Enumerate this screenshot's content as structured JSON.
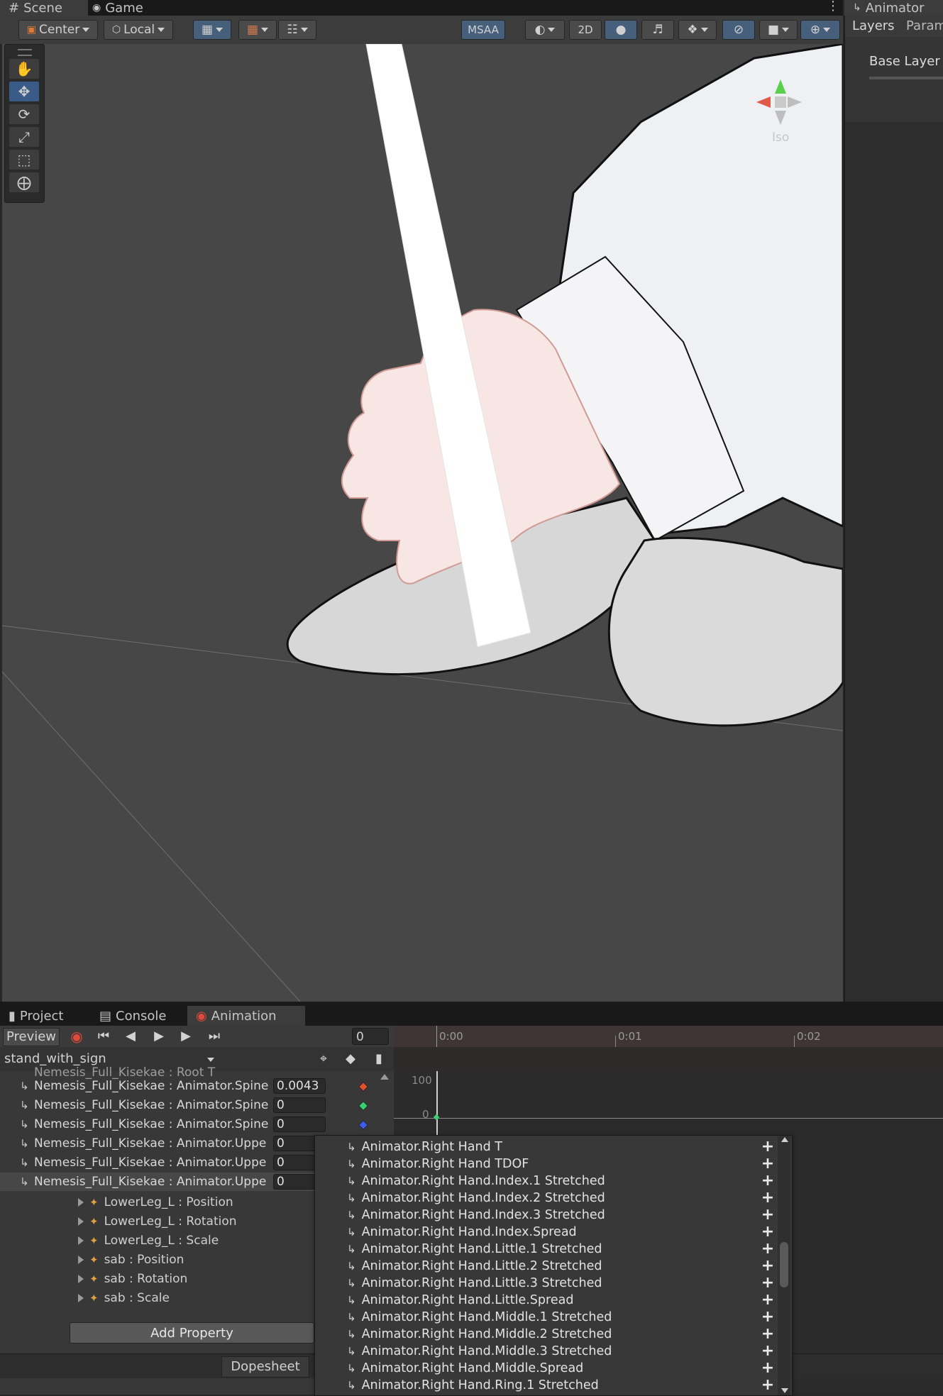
{
  "tabs": {
    "scene": "Scene",
    "game": "Game",
    "animator": "Animator"
  },
  "scene_toolbar": {
    "pivot": "Center",
    "space": "Local",
    "msaa": "MSAA",
    "mode_2d": "2D"
  },
  "scene_view": {
    "gizmo_label": "Iso"
  },
  "animator_panel": {
    "tabs": [
      "Layers",
      "Param"
    ],
    "layer": "Base Layer"
  },
  "bottom_tabs": {
    "project": "Project",
    "console": "Console",
    "animation": "Animation"
  },
  "animation": {
    "preview": "Preview",
    "frame": "0",
    "clip": "stand_with_sign",
    "ruler": [
      "0:00",
      "0:01",
      "0:02"
    ],
    "curve_ticks": [
      "100",
      "0"
    ],
    "cut_row": "Nemesis_Full_Kisekae : Root T",
    "properties": [
      {
        "name": "Nemesis_Full_Kisekae : Animator.Spine",
        "value": "0.0043",
        "key_color": "#e0502a"
      },
      {
        "name": "Nemesis_Full_Kisekae : Animator.Spine",
        "value": "0",
        "key_color": "#38d070"
      },
      {
        "name": "Nemesis_Full_Kisekae : Animator.Spine",
        "value": "0",
        "key_color": "#3c5cf0"
      },
      {
        "name": "Nemesis_Full_Kisekae : Animator.Uppe",
        "value": "0",
        "key_color": "#e0502a"
      },
      {
        "name": "Nemesis_Full_Kisekae : Animator.Uppe",
        "value": "0",
        "key_color": "#38d070"
      },
      {
        "name": "Nemesis_Full_Kisekae : Animator.Uppe",
        "value": "0",
        "key_color": "#3c5cf0"
      }
    ],
    "sub_properties": [
      "LowerLeg_L : Position",
      "LowerLeg_L : Rotation",
      "LowerLeg_L : Scale",
      "sab : Position",
      "sab : Rotation",
      "sab : Scale"
    ],
    "add_property": "Add Property",
    "dopesheet": "Dopesheet"
  },
  "dropdown": {
    "items": [
      "Animator.Right Hand T",
      "Animator.Right Hand TDOF",
      "Animator.Right Hand.Index.1 Stretched",
      "Animator.Right Hand.Index.2 Stretched",
      "Animator.Right Hand.Index.3 Stretched",
      "Animator.Right Hand.Index.Spread",
      "Animator.Right Hand.Little.1 Stretched",
      "Animator.Right Hand.Little.2 Stretched",
      "Animator.Right Hand.Little.3 Stretched",
      "Animator.Right Hand.Little.Spread",
      "Animator.Right Hand.Middle.1 Stretched",
      "Animator.Right Hand.Middle.2 Stretched",
      "Animator.Right Hand.Middle.3 Stretched",
      "Animator.Right Hand.Middle.Spread",
      "Animator.Right Hand.Ring.1 Stretched"
    ],
    "add_symbol": "+"
  },
  "colors": {
    "accent_blue": "#3a5b88",
    "record_red": "#e04a3a",
    "panel_bg": "#383838"
  }
}
